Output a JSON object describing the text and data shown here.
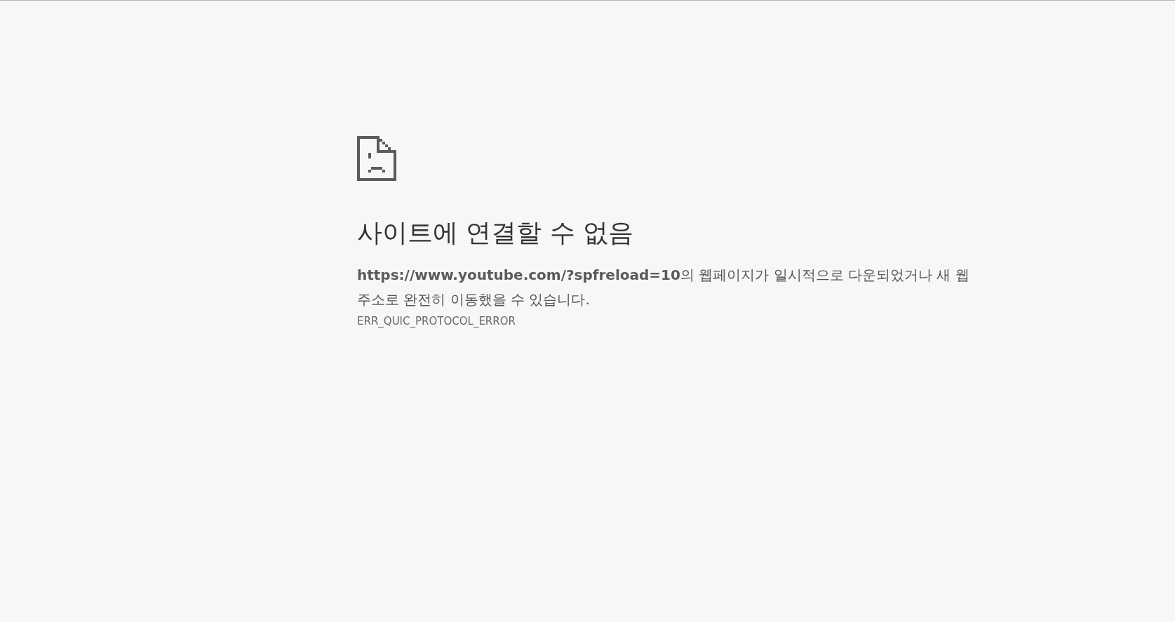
{
  "error_page": {
    "title": "사이트에 연결할 수 없음",
    "message": "**https://www.youtube.com/?spfreload=10**의 웹페이지가 일시적으로 다운되었거나 새 웹 주소로 완전히 이동했을 수 있습니다.",
    "error_code": "ERR_QUIC_PROTOCOL_ERROR"
  }
}
